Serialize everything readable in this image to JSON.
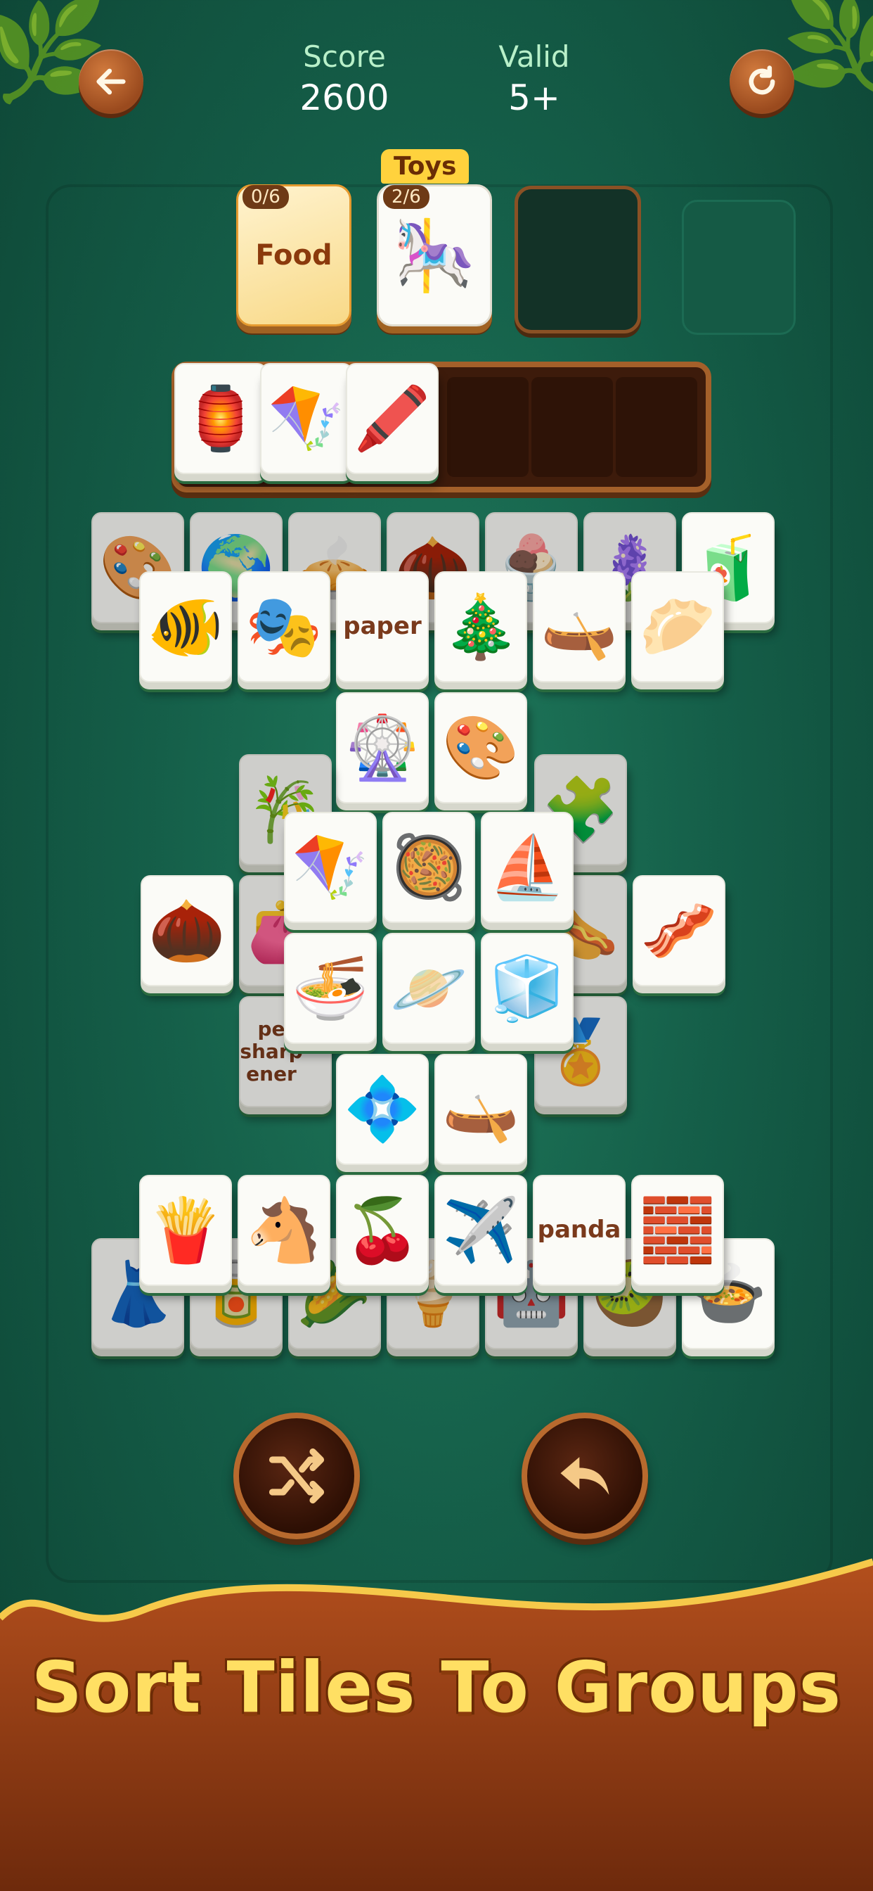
{
  "header": {
    "score_label": "Score",
    "score_value": "2600",
    "valid_label": "Valid",
    "valid_value": "5+",
    "back_icon": "arrow-left-icon",
    "restart_icon": "restart-icon"
  },
  "groups": {
    "food": {
      "count": "0/6",
      "label": "Food"
    },
    "toys": {
      "count": "2/6",
      "tag": "Toys",
      "top_item": "🎠"
    }
  },
  "tray": {
    "items": [
      "🏮",
      "🪁",
      "🖍️"
    ]
  },
  "tiles": {
    "row1": [
      "🎨",
      "🌍",
      "🥧",
      "🌰",
      "🍨",
      "🪻",
      "🧃"
    ],
    "row2": [
      "🐠",
      "🎭",
      "paper",
      "🎄",
      "🛶",
      "🥟"
    ],
    "row3": [
      "🎡",
      "🎨"
    ],
    "side_left": [
      "🎋",
      "🌰",
      "👛"
    ],
    "side_right": [
      "🧩",
      "🌭",
      "🥓",
      "🏅"
    ],
    "center_top": [
      "🪁",
      "🥘",
      "⛵"
    ],
    "center_bottom": [
      "🍜",
      "🪐",
      "🧊"
    ],
    "pencil_sharpener": "pe sharp ener",
    "row5": [
      "💠",
      "🛶"
    ],
    "row6": [
      "🍟",
      "🐴",
      "🍒",
      "✈️",
      "panda",
      "🧱"
    ],
    "row7": [
      "👗",
      "🥫",
      "🌽",
      "🍦",
      "🤖",
      "🥝",
      "🍲"
    ]
  },
  "controls": {
    "shuffle_icon": "shuffle-icon",
    "undo_icon": "undo-icon"
  },
  "banner": {
    "text": "Sort Tiles To Groups"
  },
  "colors": {
    "background": "#155f49",
    "wood": "#9a4a1e",
    "gold": "#ffdf63"
  }
}
